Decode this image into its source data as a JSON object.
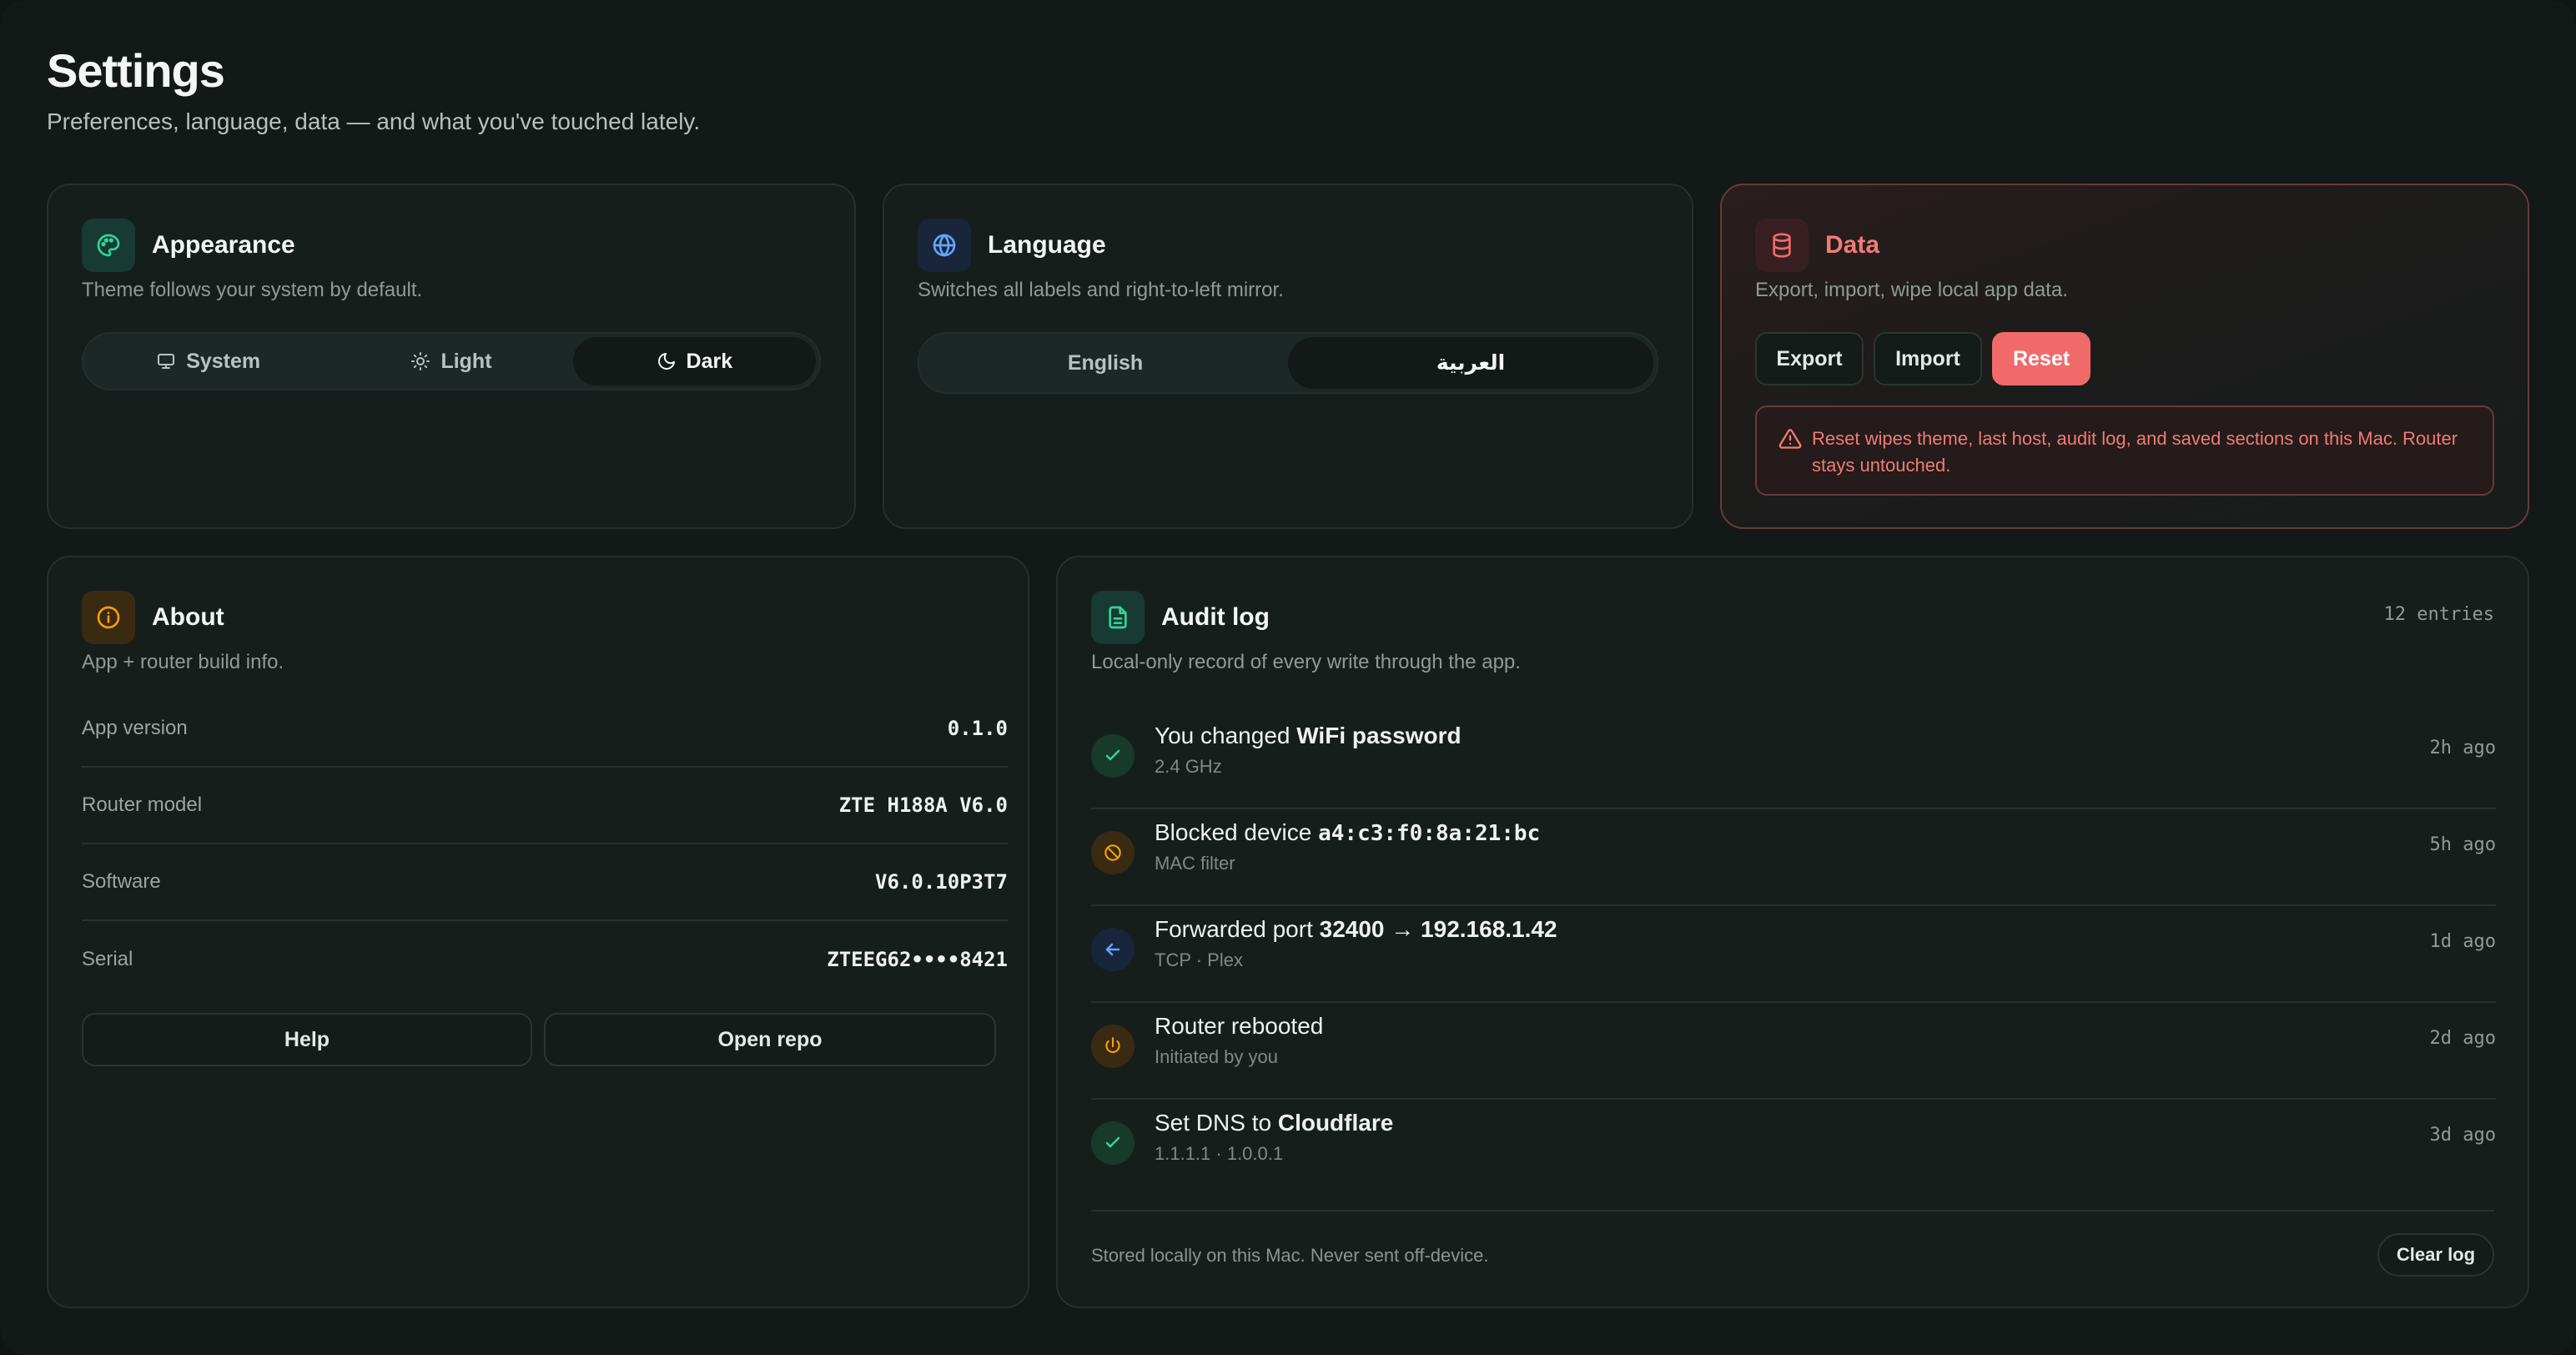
{
  "header": {
    "title": "Settings",
    "subtitle": "Preferences, language, data — and what you've touched lately."
  },
  "appearance": {
    "title": "Appearance",
    "description": "Theme follows your system by default.",
    "options": [
      "System",
      "Light",
      "Dark"
    ],
    "selected": "Dark",
    "icon": "palette-icon"
  },
  "language": {
    "title": "Language",
    "description": "Switches all labels and right-to-left mirror.",
    "options": [
      "English",
      "العربية"
    ],
    "selected": "العربية",
    "icon": "globe-icon"
  },
  "data": {
    "title": "Data",
    "description": "Export, import, wipe local app data.",
    "export_label": "Export",
    "import_label": "Import",
    "reset_label": "Reset",
    "warning": "Reset wipes theme, last host, audit log, and saved sections on this Mac. Router stays untouched.",
    "icon": "database-icon"
  },
  "about": {
    "title": "About",
    "description": "App + router build info.",
    "rows": [
      {
        "label": "App version",
        "value": "0.1.0"
      },
      {
        "label": "Router model",
        "value": "ZTE H188A V6.0"
      },
      {
        "label": "Software",
        "value": "V6.0.10P3T7"
      },
      {
        "label": "Serial",
        "value": "ZTEEG62••••8421"
      }
    ],
    "help_label": "Help",
    "repo_label": "Open repo",
    "icon": "info-icon"
  },
  "audit": {
    "title": "Audit log",
    "description": "Local-only record of every write through the app.",
    "count": "12 entries",
    "entries": [
      {
        "prefix": "You changed ",
        "strong": "WiFi password",
        "sub": "2.4 GHz",
        "time": "2h ago",
        "icon": "check-icon"
      },
      {
        "prefix": "Blocked device ",
        "strong": "a4:c3:f0:8a:21:bc",
        "sub": "MAC filter",
        "time": "5h ago",
        "icon": "block-icon"
      },
      {
        "prefix": "Forwarded port ",
        "strong": "32400 → 192.168.1.42",
        "sub": "TCP · Plex",
        "time": "1d ago",
        "icon": "arrow-left-icon"
      },
      {
        "prefix": "Router rebooted",
        "strong": "",
        "sub": "Initiated by you",
        "time": "2d ago",
        "icon": "power-icon"
      },
      {
        "prefix": "Set DNS to ",
        "strong": "Cloudflare",
        "sub": "1.1.1.1 · 1.0.0.1",
        "time": "3d ago",
        "icon": "check-icon"
      }
    ],
    "footer_note": "Stored locally on this Mac. Never sent off-device.",
    "clear_label": "Clear log",
    "icon": "document-icon"
  },
  "colors": {
    "background": "#121917",
    "card": "#161e1c",
    "accent_green": "#34d399",
    "accent_amber": "#f59e0b",
    "accent_blue": "#60a5fa",
    "danger": "#f06a6a"
  }
}
